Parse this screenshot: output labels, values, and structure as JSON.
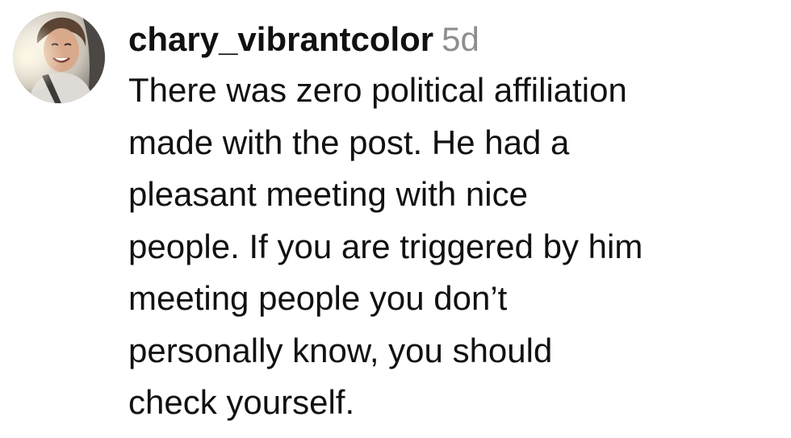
{
  "comment": {
    "username": "chary_vibrantcolor",
    "timestamp": "5d",
    "lines": [
      "There was zero political affiliation",
      "made with the post. He had a",
      "pleasant meeting with nice",
      "people. If you are triggered by him",
      "meeting people you don’t",
      "personally know, you should",
      "check yourself."
    ]
  }
}
